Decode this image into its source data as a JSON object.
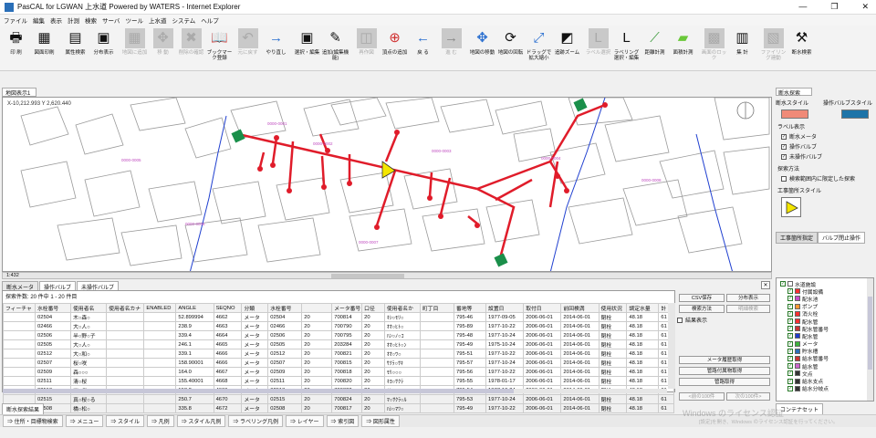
{
  "window": {
    "title": "PasCAL for LGWAN 上水道 Powered by WATERS - Internet Explorer",
    "minimize": "—",
    "restore": "❐",
    "close": "✕"
  },
  "menu": [
    "ファイル",
    "編集",
    "表示",
    "計測",
    "検索",
    "サーバ",
    "ツール",
    "上水道",
    "システム",
    "ヘルプ"
  ],
  "toolbar": [
    {
      "label": "印 刷",
      "icon": "printer-icon"
    },
    {
      "label": "図面印刷",
      "icon": "map-print-icon"
    },
    {
      "label": "属性検索",
      "icon": "attribute-search-icon"
    },
    {
      "label": "分布表示",
      "icon": "distribution-icon"
    },
    {
      "label": "地図に追加",
      "icon": "layer-add-icon",
      "disabled": true
    },
    {
      "label": "移 動",
      "icon": "move-icon",
      "disabled": true
    },
    {
      "label": "削除の確認",
      "icon": "delete-check-icon",
      "disabled": true
    },
    {
      "label": "ブックマーク登録",
      "icon": "bookmark-icon"
    },
    {
      "label": "元に戻す",
      "icon": "undo-icon",
      "disabled": true
    },
    {
      "label": "やり直し",
      "icon": "redo-icon"
    },
    {
      "label": "選択・編集",
      "icon": "select-edit-icon"
    },
    {
      "label": "追加(編集機能)",
      "icon": "add-edit-icon"
    },
    {
      "label": "再作図",
      "icon": "redraw-icon",
      "disabled": true
    },
    {
      "label": "頂点の追加",
      "icon": "vertex-add-icon"
    },
    {
      "label": "戻 る",
      "icon": "back-icon"
    },
    {
      "label": "進 む",
      "icon": "forward-icon",
      "disabled": true
    },
    {
      "label": "地図の移動",
      "icon": "pan-icon"
    },
    {
      "label": "地図の回転",
      "icon": "rotate-icon"
    },
    {
      "label": "ドラッグで拡大縮小",
      "icon": "drag-zoom-icon"
    },
    {
      "label": "追跡ズーム",
      "icon": "zoom-track-icon"
    },
    {
      "label": "ラベル選択",
      "icon": "label-icon",
      "disabled": true
    },
    {
      "label": "ラベリング選択・編集",
      "icon": "labeling-icon"
    },
    {
      "label": "距離計測",
      "icon": "distance-icon"
    },
    {
      "label": "面積計測",
      "icon": "area-icon"
    },
    {
      "label": "画面のロック",
      "icon": "lock-icon",
      "disabled": true
    },
    {
      "label": "集 計",
      "icon": "sum-icon"
    },
    {
      "label": "ファイリング連動",
      "icon": "filing-icon",
      "disabled": true
    },
    {
      "label": "断水検索",
      "icon": "cutoff-search-icon"
    }
  ],
  "map": {
    "tab": "地図表示1",
    "coord": "X-10,212.993 Y 2,620.440",
    "scale_label": "1:432"
  },
  "right_panel": {
    "header": "断水探索",
    "cutoff_style": "断水スタイル",
    "valve_style": "操作バルブスタイル",
    "label_display": "ラベル表示",
    "checks": [
      "断水メータ",
      "操作バルブ",
      "未操作バルブ"
    ],
    "search_method": "探索方法",
    "search_range": "検索範囲内に限定した探索",
    "work_style": "工事箇所スタイル",
    "tabs": [
      "工事箇所指定",
      "バルブ閉止操作"
    ],
    "colors": {
      "cutoff": "#f08a78",
      "valve": "#1e74a8"
    }
  },
  "bottom_tabs": [
    "断水メータ",
    "操作バルブ",
    "未操作バルブ"
  ],
  "grid": {
    "count_text": "探索件数: 20 件中 1 - 20 件目",
    "columns": [
      "フィーチャ",
      "水栓番号",
      "使用者名",
      "使用者名カナ",
      "ENABLED",
      "ANGLE",
      "SEQNO",
      "分類",
      "水栓番号",
      "メータ番号",
      "口径",
      "使用者名か",
      "町丁目",
      "番地等",
      "設置日",
      "取付日",
      "前回検満",
      "使用状況",
      "調定水量",
      "計"
    ],
    "rows": [
      [
        "",
        "02504",
        "木○森○",
        "",
        "",
        "52.899994",
        "4662",
        "メータ",
        "02504",
        "20",
        "700814",
        "20",
        "ｷｼ○ﾓﾘ○",
        "",
        "795-46",
        "1977-09-05",
        "2006-06-01",
        "2014-06-01",
        "閉栓",
        "48.18",
        "61"
      ],
      [
        "",
        "02466",
        "大○人○",
        "",
        "",
        "238.9",
        "4663",
        "メータ",
        "02466",
        "20",
        "700790",
        "20",
        "ｵｵ○ﾋﾄ○",
        "",
        "795-89",
        "1977-10-22",
        "2006-06-01",
        "2014-06-01",
        "閉栓",
        "48.18",
        "61"
      ],
      [
        "",
        "02506",
        "半○野○子",
        "",
        "",
        "339.4",
        "4664",
        "メータ",
        "02506",
        "20",
        "700795",
        "20",
        "ﾊﾝ○ﾉ○ｺ",
        "",
        "795-48",
        "1977-10-24",
        "2006-06-01",
        "2014-06-01",
        "閉栓",
        "48.18",
        "61"
      ],
      [
        "",
        "02505",
        "大○人○",
        "",
        "",
        "246.1",
        "4665",
        "メータ",
        "02505",
        "20",
        "203284",
        "20",
        "ｵｵ○ﾋﾄ○ﾝ",
        "",
        "795-49",
        "1975-10-24",
        "2006-06-01",
        "2014-06-01",
        "閉栓",
        "48.18",
        "61"
      ],
      [
        "",
        "02512",
        "大○和○",
        "",
        "",
        "339.1",
        "4666",
        "メータ",
        "02512",
        "20",
        "700821",
        "20",
        "ｵｵ○ﾜ○",
        "",
        "795-51",
        "1977-10-22",
        "2006-06-01",
        "2014-06-01",
        "閉栓",
        "48.18",
        "61"
      ],
      [
        "",
        "02507",
        "桜○咲",
        "",
        "",
        "158.90001",
        "4666",
        "メータ",
        "02507",
        "20",
        "700815",
        "20",
        "ｻｸﾗ○ｻｷ",
        "",
        "795-57",
        "1977-10-24",
        "2006-06-01",
        "2014-06-01",
        "閉栓",
        "48.18",
        "61"
      ],
      [
        "",
        "02509",
        "森○○○",
        "",
        "",
        "164.0",
        "4667",
        "メータ",
        "02509",
        "20",
        "700818",
        "20",
        "ﾓﾘ○○○",
        "",
        "795-56",
        "1977-10-22",
        "2006-06-01",
        "2014-06-01",
        "閉栓",
        "48.18",
        "61"
      ],
      [
        "",
        "02511",
        "清○桜",
        "",
        "",
        "155.40001",
        "4668",
        "メータ",
        "02511",
        "20",
        "700820",
        "20",
        "ｷﾖ○ｻｸﾗ",
        "",
        "795-55",
        "1978-01-17",
        "2006-06-01",
        "2014-06-01",
        "閉栓",
        "48.18",
        "61"
      ],
      [
        "",
        "02513",
        "岸○代○",
        "",
        "",
        "158.2",
        "4669",
        "メータ",
        "02513",
        "20",
        "700822",
        "20",
        "ｷｼ○ﾖ○",
        "",
        "795-54",
        "1977-10-24",
        "2006-06-01",
        "2014-06-01",
        "閉栓",
        "48.18",
        "61"
      ],
      [
        "",
        "02515",
        "真○桜○る",
        "",
        "",
        "250.7",
        "4670",
        "メータ",
        "02515",
        "20",
        "700824",
        "20",
        "ﾏ○ｻｸﾗ○ﾙ",
        "",
        "795-53",
        "1977-10-24",
        "2006-06-01",
        "2014-06-01",
        "閉栓",
        "48.18",
        "61"
      ],
      [
        "",
        "02508",
        "橋○松○",
        "",
        "",
        "335.8",
        "4672",
        "メータ",
        "02508",
        "20",
        "700817",
        "20",
        "ﾊｼ○ﾏﾂ○",
        "",
        "795-49",
        "1977-10-22",
        "2006-06-01",
        "2014-06-01",
        "閉栓",
        "48.18",
        "61"
      ]
    ]
  },
  "actions": {
    "csv_save": "CSV保存",
    "distribution": "分布表示",
    "search_method": "検索方法",
    "reverse": "明細検索",
    "result_display": "結果表示",
    "meter_history": "メータ履歴取得",
    "pipe_facility": "管路付属物取得",
    "pipe_get": "管路取得",
    "prev": "<前の100件",
    "next": "次の100件>"
  },
  "tree": {
    "items": [
      {
        "label": "水道施設",
        "color": "#ffffff",
        "level": 0
      },
      {
        "label": "付属設備",
        "color": "#ff3030",
        "level": 1
      },
      {
        "label": "配水池",
        "color": "#c84cc8",
        "level": 1
      },
      {
        "label": "ポンプ",
        "color": "#ff9933",
        "level": 1
      },
      {
        "label": "消火栓",
        "color": "#ff3030",
        "level": 1
      },
      {
        "label": "配水管",
        "color": "#ff3030",
        "level": 1
      },
      {
        "label": "配水管番号",
        "color": "#cc3333",
        "level": 1
      },
      {
        "label": "配水管",
        "color": "#1f3dcc",
        "level": 1
      },
      {
        "label": "メータ",
        "color": "#3cb43c",
        "level": 1
      },
      {
        "label": "貯水槽",
        "color": "#2a6fb8",
        "level": 1
      },
      {
        "label": "給水管番号",
        "color": "#cc3333",
        "level": 1
      },
      {
        "label": "給水管",
        "color": "#cc66cc",
        "level": 1
      },
      {
        "label": "文点",
        "color": "#333333",
        "level": 1
      },
      {
        "label": "給水支点",
        "color": "#333333",
        "level": 1
      },
      {
        "label": "給水分岐点",
        "color": "#333333",
        "level": 1
      }
    ],
    "container_tab": "コンテナセット"
  },
  "bottom_section_tab": "断水探索結果",
  "taskbar": [
    "住所・目標物検索",
    "メニュー",
    "スタイル",
    "凡例",
    "スタイル凡例",
    "ラベリング凡例",
    "レイヤー",
    "索引図",
    "図形属性"
  ],
  "watermark": {
    "line1": "Windows のライセンス認証",
    "line2": "[設定]を開き、Windows のライセンス認証を行ってください。"
  }
}
